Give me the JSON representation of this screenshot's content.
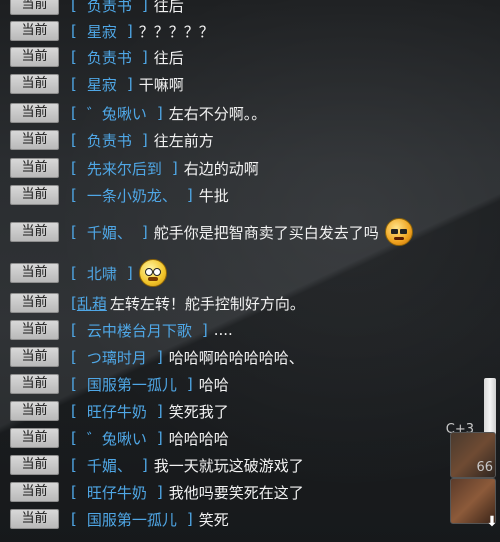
{
  "tag_label": "当前",
  "bracket_open": "[",
  "bracket_close": "]",
  "messages": [
    {
      "name": "负责书",
      "text": "往后"
    },
    {
      "name": "星寂",
      "text": "？？？？？"
    },
    {
      "name": "负责书",
      "text": "往后"
    },
    {
      "name": "星寂",
      "text": "干嘛啊"
    },
    {
      "name": "゛兔啾い",
      "text": "左右不分啊。。"
    },
    {
      "name": "负责书",
      "text": "往左前方"
    },
    {
      "name": "先来尔后到",
      "text": "右边的动啊"
    },
    {
      "name": "一条小奶龙、",
      "text": "牛批"
    },
    {
      "name": "千媚、",
      "text": "舵手你是把智商卖了买白发去了吗",
      "emoji": "angry-face-emoji"
    },
    {
      "name": "北啸",
      "text": "",
      "emoji": "shocked-face-emoji"
    },
    {
      "name": "乱葙",
      "text": "左转左转！舵手控制好方向。",
      "link": true
    },
    {
      "name": "云中楼台月下歌",
      "text": "...."
    },
    {
      "name": "つ璃时月",
      "text": "哈哈啊哈哈哈哈哈、"
    },
    {
      "name": "国服第一孤儿",
      "text": "哈哈"
    },
    {
      "name": "旺仔牛奶",
      "text": "笑死我了"
    },
    {
      "name": "゛兔啾い",
      "text": "哈哈哈哈"
    },
    {
      "name": "千媚、",
      "text": "我一天就玩这破游戏了"
    },
    {
      "name": "旺仔牛奶",
      "text": "我他吗要笑死在这了"
    },
    {
      "name": "国服第一孤儿",
      "text": "笑死"
    }
  ],
  "side": {
    "slot1_label": "C+3",
    "slot1_count": "66",
    "scroll_icon": "scroll-down-arrow-icon"
  }
}
